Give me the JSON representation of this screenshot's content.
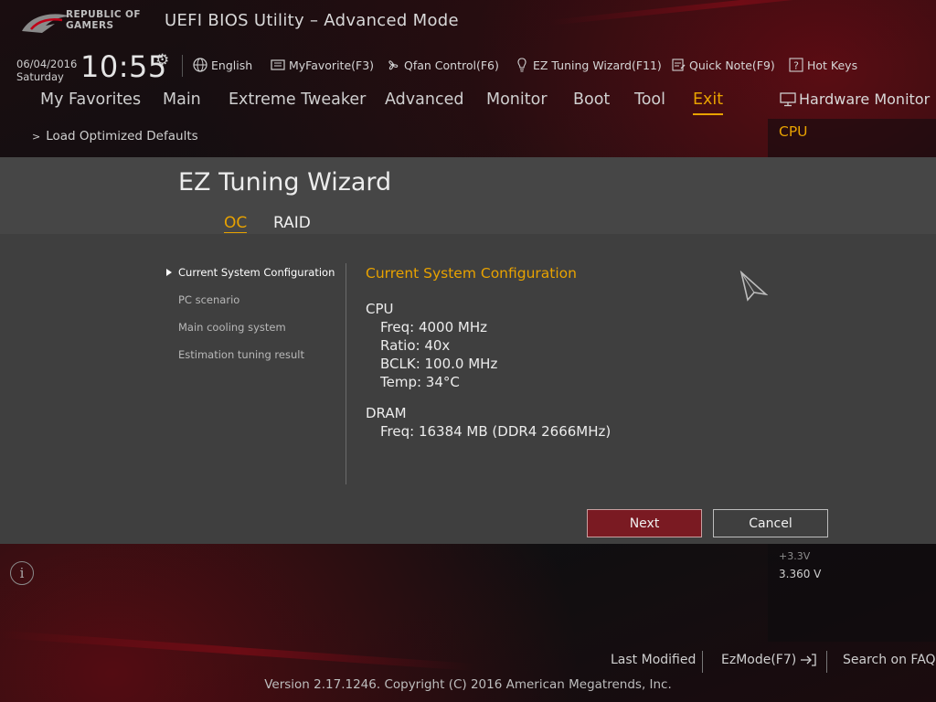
{
  "header": {
    "logo_line1": "REPUBLIC OF",
    "logo_line2": "GAMERS",
    "title": "UEFI BIOS Utility – Advanced Mode",
    "date": "06/04/2016",
    "day": "Saturday",
    "time": "10:55"
  },
  "toolbar": [
    {
      "label": "English",
      "icon": "globe-icon"
    },
    {
      "label": "MyFavorite(F3)",
      "icon": "favorite-icon"
    },
    {
      "label": "Qfan Control(F6)",
      "icon": "fan-icon"
    },
    {
      "label": "EZ Tuning Wizard(F11)",
      "icon": "lightbulb-icon"
    },
    {
      "label": "Quick Note(F9)",
      "icon": "note-icon"
    },
    {
      "label": "Hot Keys",
      "icon": "help-icon"
    }
  ],
  "nav": {
    "tabs": [
      "My Favorites",
      "Main",
      "Extreme Tweaker",
      "Advanced",
      "Monitor",
      "Boot",
      "Tool",
      "Exit"
    ],
    "active": "Exit"
  },
  "exit_menu": {
    "item": "Load Optimized Defaults"
  },
  "hardware_monitor": {
    "title": "Hardware Monitor",
    "section": "CPU",
    "voltage_label": "+3.3V",
    "voltage_value": "3.360 V"
  },
  "wizard": {
    "title": "EZ Tuning Wizard",
    "tabs": [
      "OC",
      "RAID"
    ],
    "active_tab": "OC",
    "steps": [
      "Current System Configuration",
      "PC scenario",
      "Main cooling system",
      "Estimation tuning result"
    ],
    "current_step": "Current System Configuration",
    "config_title": "Current System Configuration",
    "cpu_heading": "CPU",
    "cpu": [
      "Freq: 4000 MHz",
      "Ratio: 40x",
      "BCLK: 100.0 MHz",
      "Temp: 34°C"
    ],
    "dram_heading": "DRAM",
    "dram": [
      "Freq: 16384 MB (DDR4 2666MHz)"
    ],
    "next_label": "Next",
    "cancel_label": "Cancel"
  },
  "footer": {
    "last_modified": "Last Modified",
    "ezmode": "EzMode(F7)",
    "search": "Search on FAQ",
    "copyright": "Version 2.17.1246. Copyright (C) 2016 American Megatrends, Inc."
  },
  "colors": {
    "accent": "#e8a200",
    "next_button": "#7a1a22",
    "dialog_bg": "#3f3f3f"
  }
}
